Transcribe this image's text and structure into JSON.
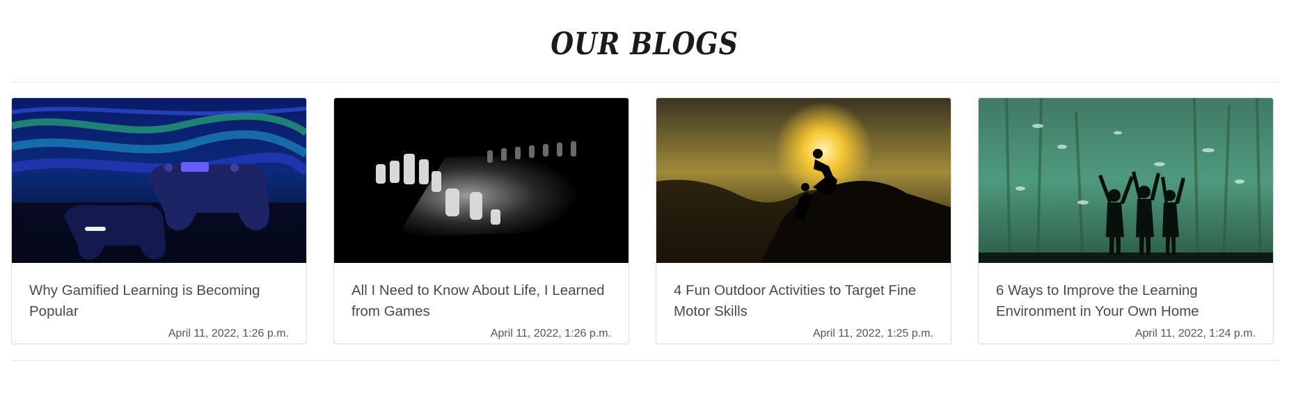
{
  "section": {
    "title": "OUR BLOGS"
  },
  "posts": [
    {
      "title": "Why Gamified Learning is Becoming Popular",
      "date": "April 11, 2022, 1:26 p.m.",
      "image": "game-controllers-image"
    },
    {
      "title": "All I Need to Know About Life, I Learned from Games",
      "date": "April 11, 2022, 1:26 p.m.",
      "image": "chess-board-image"
    },
    {
      "title": "4 Fun Outdoor Activities to Target Fine Motor Skills",
      "date": "April 11, 2022, 1:25 p.m.",
      "image": "climbers-sunset-image"
    },
    {
      "title": "6 Ways to Improve the Learning Environment in Your Own Home",
      "date": "April 11, 2022, 1:24 p.m.",
      "image": "aquarium-children-image"
    }
  ],
  "colors": {
    "title": "#1b1b1b",
    "text": "#4a4a4a",
    "border": "#dcdcdc",
    "rule": "#e4e4e4"
  }
}
